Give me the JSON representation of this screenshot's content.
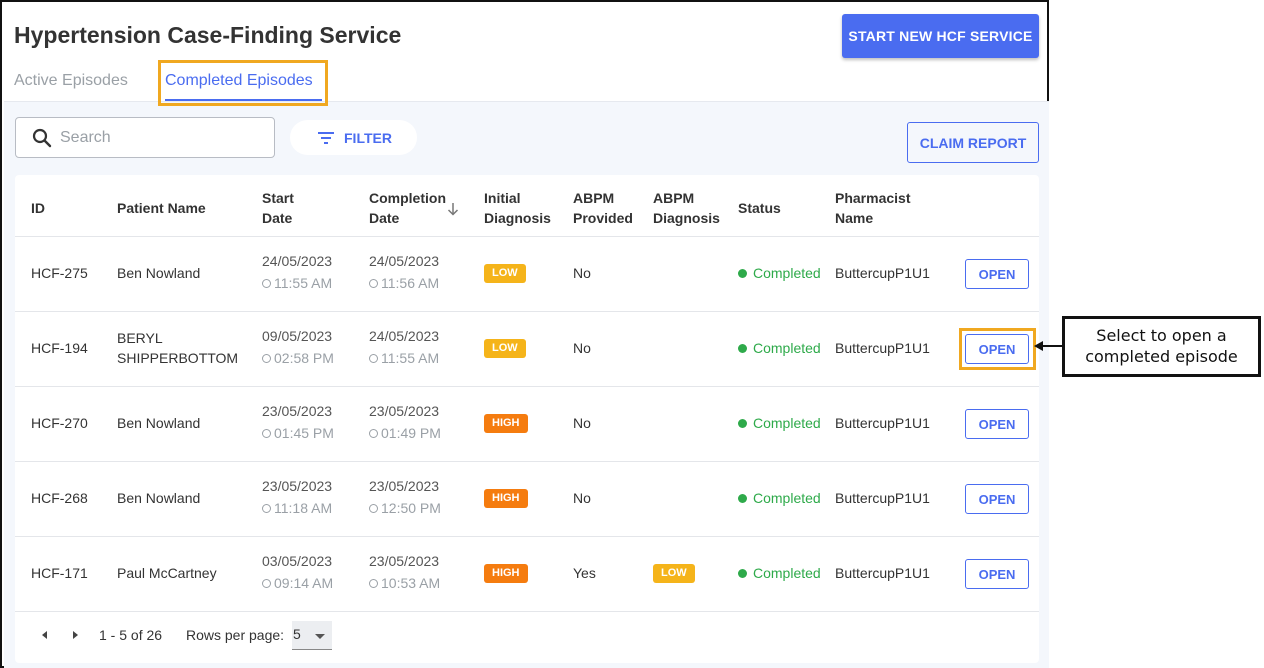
{
  "header": {
    "title": "Hypertension Case-Finding Service",
    "start_button": "START NEW HCF SERVICE"
  },
  "tabs": [
    {
      "label": "Active Episodes",
      "active": false
    },
    {
      "label": "Completed Episodes",
      "active": true
    }
  ],
  "toolbar": {
    "search_placeholder": "Search",
    "filter_label": "FILTER",
    "claim_report_label": "CLAIM REPORT"
  },
  "table": {
    "columns": {
      "id": "ID",
      "patient_name": "Patient Name",
      "start_date_1": "Start",
      "start_date_2": "Date",
      "completion_date_1": "Completion",
      "completion_date_2": "Date",
      "initial_diagnosis_1": "Initial",
      "initial_diagnosis_2": "Diagnosis",
      "abpm_provided_1": "ABPM",
      "abpm_provided_2": "Provided",
      "abpm_diagnosis_1": "ABPM",
      "abpm_diagnosis_2": "Diagnosis",
      "status": "Status",
      "pharmacist_1": "Pharmacist",
      "pharmacist_2": "Name"
    },
    "sorted_column": "completion_date",
    "sort_direction": "descending",
    "rows": [
      {
        "id": "HCF-275",
        "name_1": "Ben Nowland",
        "name_2": "",
        "start_date": "24/05/2023",
        "start_time": "11:55 AM",
        "completion_date": "24/05/2023",
        "completion_time": "11:56 AM",
        "initial_diagnosis": "LOW",
        "abpm_provided": "No",
        "abpm_diagnosis": "",
        "status": "Completed",
        "pharmacist": "ButtercupP1U1",
        "action": "OPEN"
      },
      {
        "id": "HCF-194",
        "name_1": "BERYL",
        "name_2": "SHIPPERBOTTOM",
        "start_date": "09/05/2023",
        "start_time": "02:58 PM",
        "completion_date": "24/05/2023",
        "completion_time": "11:55 AM",
        "initial_diagnosis": "LOW",
        "abpm_provided": "No",
        "abpm_diagnosis": "",
        "status": "Completed",
        "pharmacist": "ButtercupP1U1",
        "action": "OPEN"
      },
      {
        "id": "HCF-270",
        "name_1": "Ben Nowland",
        "name_2": "",
        "start_date": "23/05/2023",
        "start_time": "01:45 PM",
        "completion_date": "23/05/2023",
        "completion_time": "01:49 PM",
        "initial_diagnosis": "HIGH",
        "abpm_provided": "No",
        "abpm_diagnosis": "",
        "status": "Completed",
        "pharmacist": "ButtercupP1U1",
        "action": "OPEN"
      },
      {
        "id": "HCF-268",
        "name_1": "Ben Nowland",
        "name_2": "",
        "start_date": "23/05/2023",
        "start_time": "11:18 AM",
        "completion_date": "23/05/2023",
        "completion_time": "12:50 PM",
        "initial_diagnosis": "HIGH",
        "abpm_provided": "No",
        "abpm_diagnosis": "",
        "status": "Completed",
        "pharmacist": "ButtercupP1U1",
        "action": "OPEN"
      },
      {
        "id": "HCF-171",
        "name_1": "Paul McCartney",
        "name_2": "",
        "start_date": "03/05/2023",
        "start_time": "09:14 AM",
        "completion_date": "23/05/2023",
        "completion_time": "10:53 AM",
        "initial_diagnosis": "HIGH",
        "abpm_provided": "Yes",
        "abpm_diagnosis": "LOW",
        "status": "Completed",
        "pharmacist": "ButtercupP1U1",
        "action": "OPEN"
      }
    ]
  },
  "pagination": {
    "range": "1 - 5 of 26",
    "rows_per_page_label": "Rows per page:",
    "rows_per_page_value": "5"
  },
  "annotation": {
    "line1": "Select to open a",
    "line2": "completed episode"
  },
  "colors": {
    "primary": "#4a6cf0",
    "low_badge": "#f5b41a",
    "high_badge": "#f57c0f",
    "status_completed": "#2eaa4a",
    "highlight": "#f0a820"
  },
  "icons": [
    "search-icon",
    "filter-icon",
    "sort-arrow-down-icon",
    "clock-icon",
    "chevron-left-icon",
    "chevron-right-icon",
    "dropdown-caret-icon"
  ]
}
